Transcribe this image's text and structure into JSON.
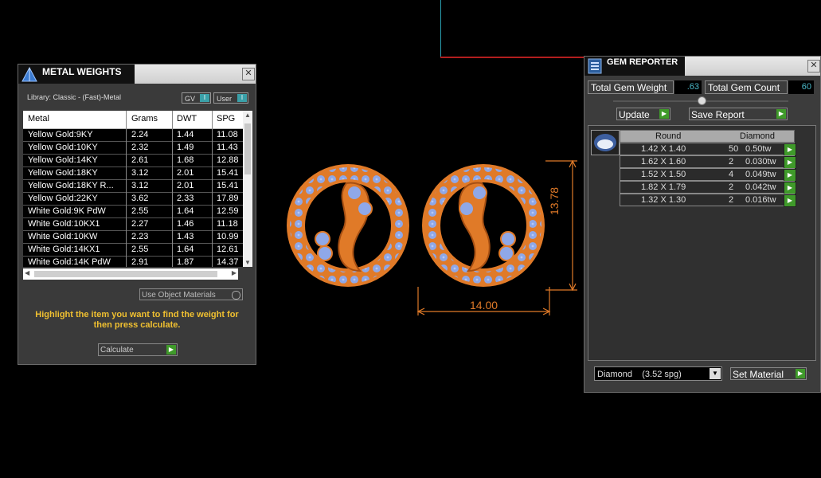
{
  "metal_weights": {
    "title": "METAL WEIGHTS",
    "close": "✕",
    "library": "Library: Classic - (Fast)-Metal",
    "toggles": [
      {
        "label": "GV",
        "indicator": "I"
      },
      {
        "label": "User",
        "indicator": "I"
      }
    ],
    "columns": [
      "Metal",
      "Grams",
      "DWT",
      "SPG"
    ],
    "rows": [
      [
        "Yellow Gold:9KY",
        "2.24",
        "1.44",
        "11.08"
      ],
      [
        "Yellow Gold:10KY",
        "2.32",
        "1.49",
        "11.43"
      ],
      [
        "Yellow Gold:14KY",
        "2.61",
        "1.68",
        "12.88"
      ],
      [
        "Yellow Gold:18KY",
        "3.12",
        "2.01",
        "15.41"
      ],
      [
        "Yellow Gold:18KY R...",
        "3.12",
        "2.01",
        "15.41"
      ],
      [
        "Yellow Gold:22KY",
        "3.62",
        "2.33",
        "17.89"
      ],
      [
        "White Gold:9K PdW",
        "2.55",
        "1.64",
        "12.59"
      ],
      [
        "White Gold:10KX1",
        "2.27",
        "1.46",
        "11.18"
      ],
      [
        "White Gold:10KW",
        "2.23",
        "1.43",
        "10.99"
      ],
      [
        "White Gold:14KX1",
        "2.55",
        "1.64",
        "12.61"
      ],
      [
        "White Gold:14K PdW",
        "2.91",
        "1.87",
        "14.37"
      ]
    ],
    "use_object_materials": "Use Object Materials",
    "hint": "Highlight the item you want to find the weight for then press calculate.",
    "calculate": "Calculate"
  },
  "gem_reporter": {
    "title": "GEM REPORTER",
    "close": "✕",
    "total_gem_weight_label": "Total Gem Weight",
    "total_gem_weight": ".63",
    "total_gem_count_label": "Total Gem Count",
    "total_gem_count": "60",
    "update": "Update",
    "save_report": "Save Report",
    "table_headers": [
      "Round",
      "Diamond"
    ],
    "gems": [
      {
        "size": "1.42 X 1.40",
        "count": "50",
        "weight": "0.50tw"
      },
      {
        "size": "1.62 X 1.60",
        "count": "2",
        "weight": "0.030tw"
      },
      {
        "size": "1.52 X 1.50",
        "count": "4",
        "weight": "0.049tw"
      },
      {
        "size": "1.82 X 1.79",
        "count": "2",
        "weight": "0.042tw"
      },
      {
        "size": "1.32 X 1.30",
        "count": "2",
        "weight": "0.016tw"
      }
    ],
    "material_select": "Diamond    (3.52 spg)",
    "set_material": "Set Material"
  },
  "viewport": {
    "dim_width": "14.00",
    "dim_height": "13.78"
  },
  "colors": {
    "accent_green": "#3f9a2a",
    "accent_teal": "#3aa0a8",
    "gold": "#e07a28",
    "gem": "#8fa8e8"
  }
}
